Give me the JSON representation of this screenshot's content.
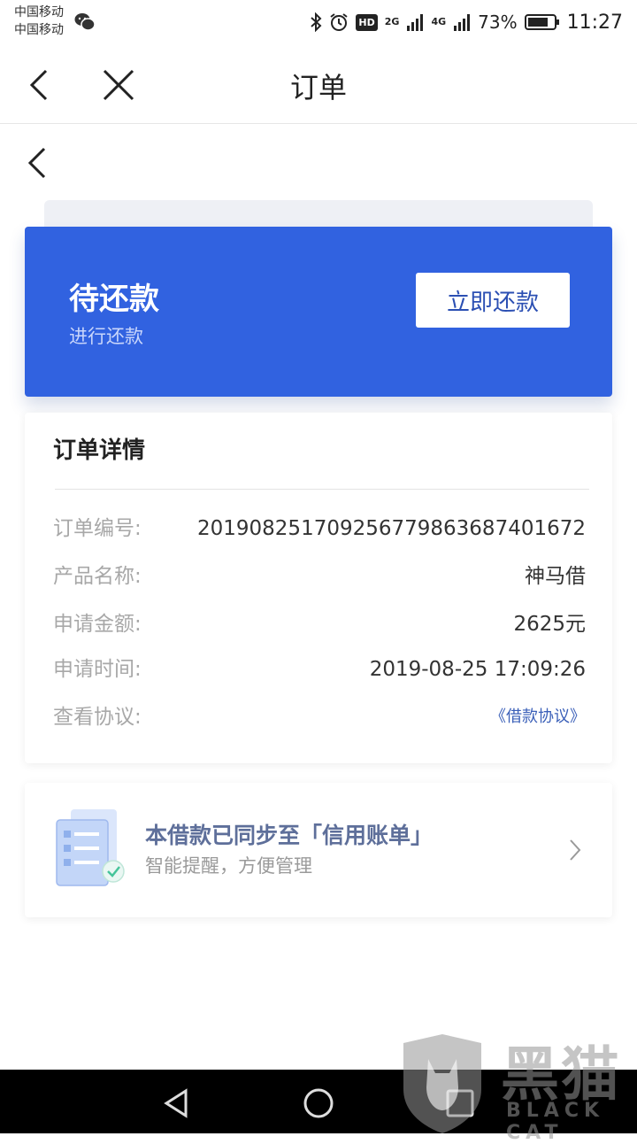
{
  "status_bar": {
    "carrier_1": "中国移动",
    "carrier_2": "中国移动",
    "net_2g": "2G",
    "net_4g": "4G",
    "hd": "HD",
    "battery": "73%",
    "time": "11:27"
  },
  "nav": {
    "title": "订单"
  },
  "status_card": {
    "title": "待还款",
    "subtitle": "进行还款",
    "pay_button": "立即还款",
    "accent": "#3162e0"
  },
  "details": {
    "title": "订单详情",
    "rows": [
      {
        "label": "订单编号:",
        "value": "20190825170925677986368740​1672"
      },
      {
        "label": "产品名称:",
        "value": "神马借"
      },
      {
        "label": "申请金额:",
        "value": "2625元"
      },
      {
        "label": "申请时间:",
        "value": "2019-08-25 17:09:26"
      },
      {
        "label": "查看协议:",
        "value": "《借款协议》"
      }
    ]
  },
  "sync": {
    "title": "本借款已同步至「信用账单」",
    "subtitle": "智能提醒，方便管理"
  },
  "watermark": {
    "cn": "黑猫",
    "en": "BLACK CAT"
  }
}
